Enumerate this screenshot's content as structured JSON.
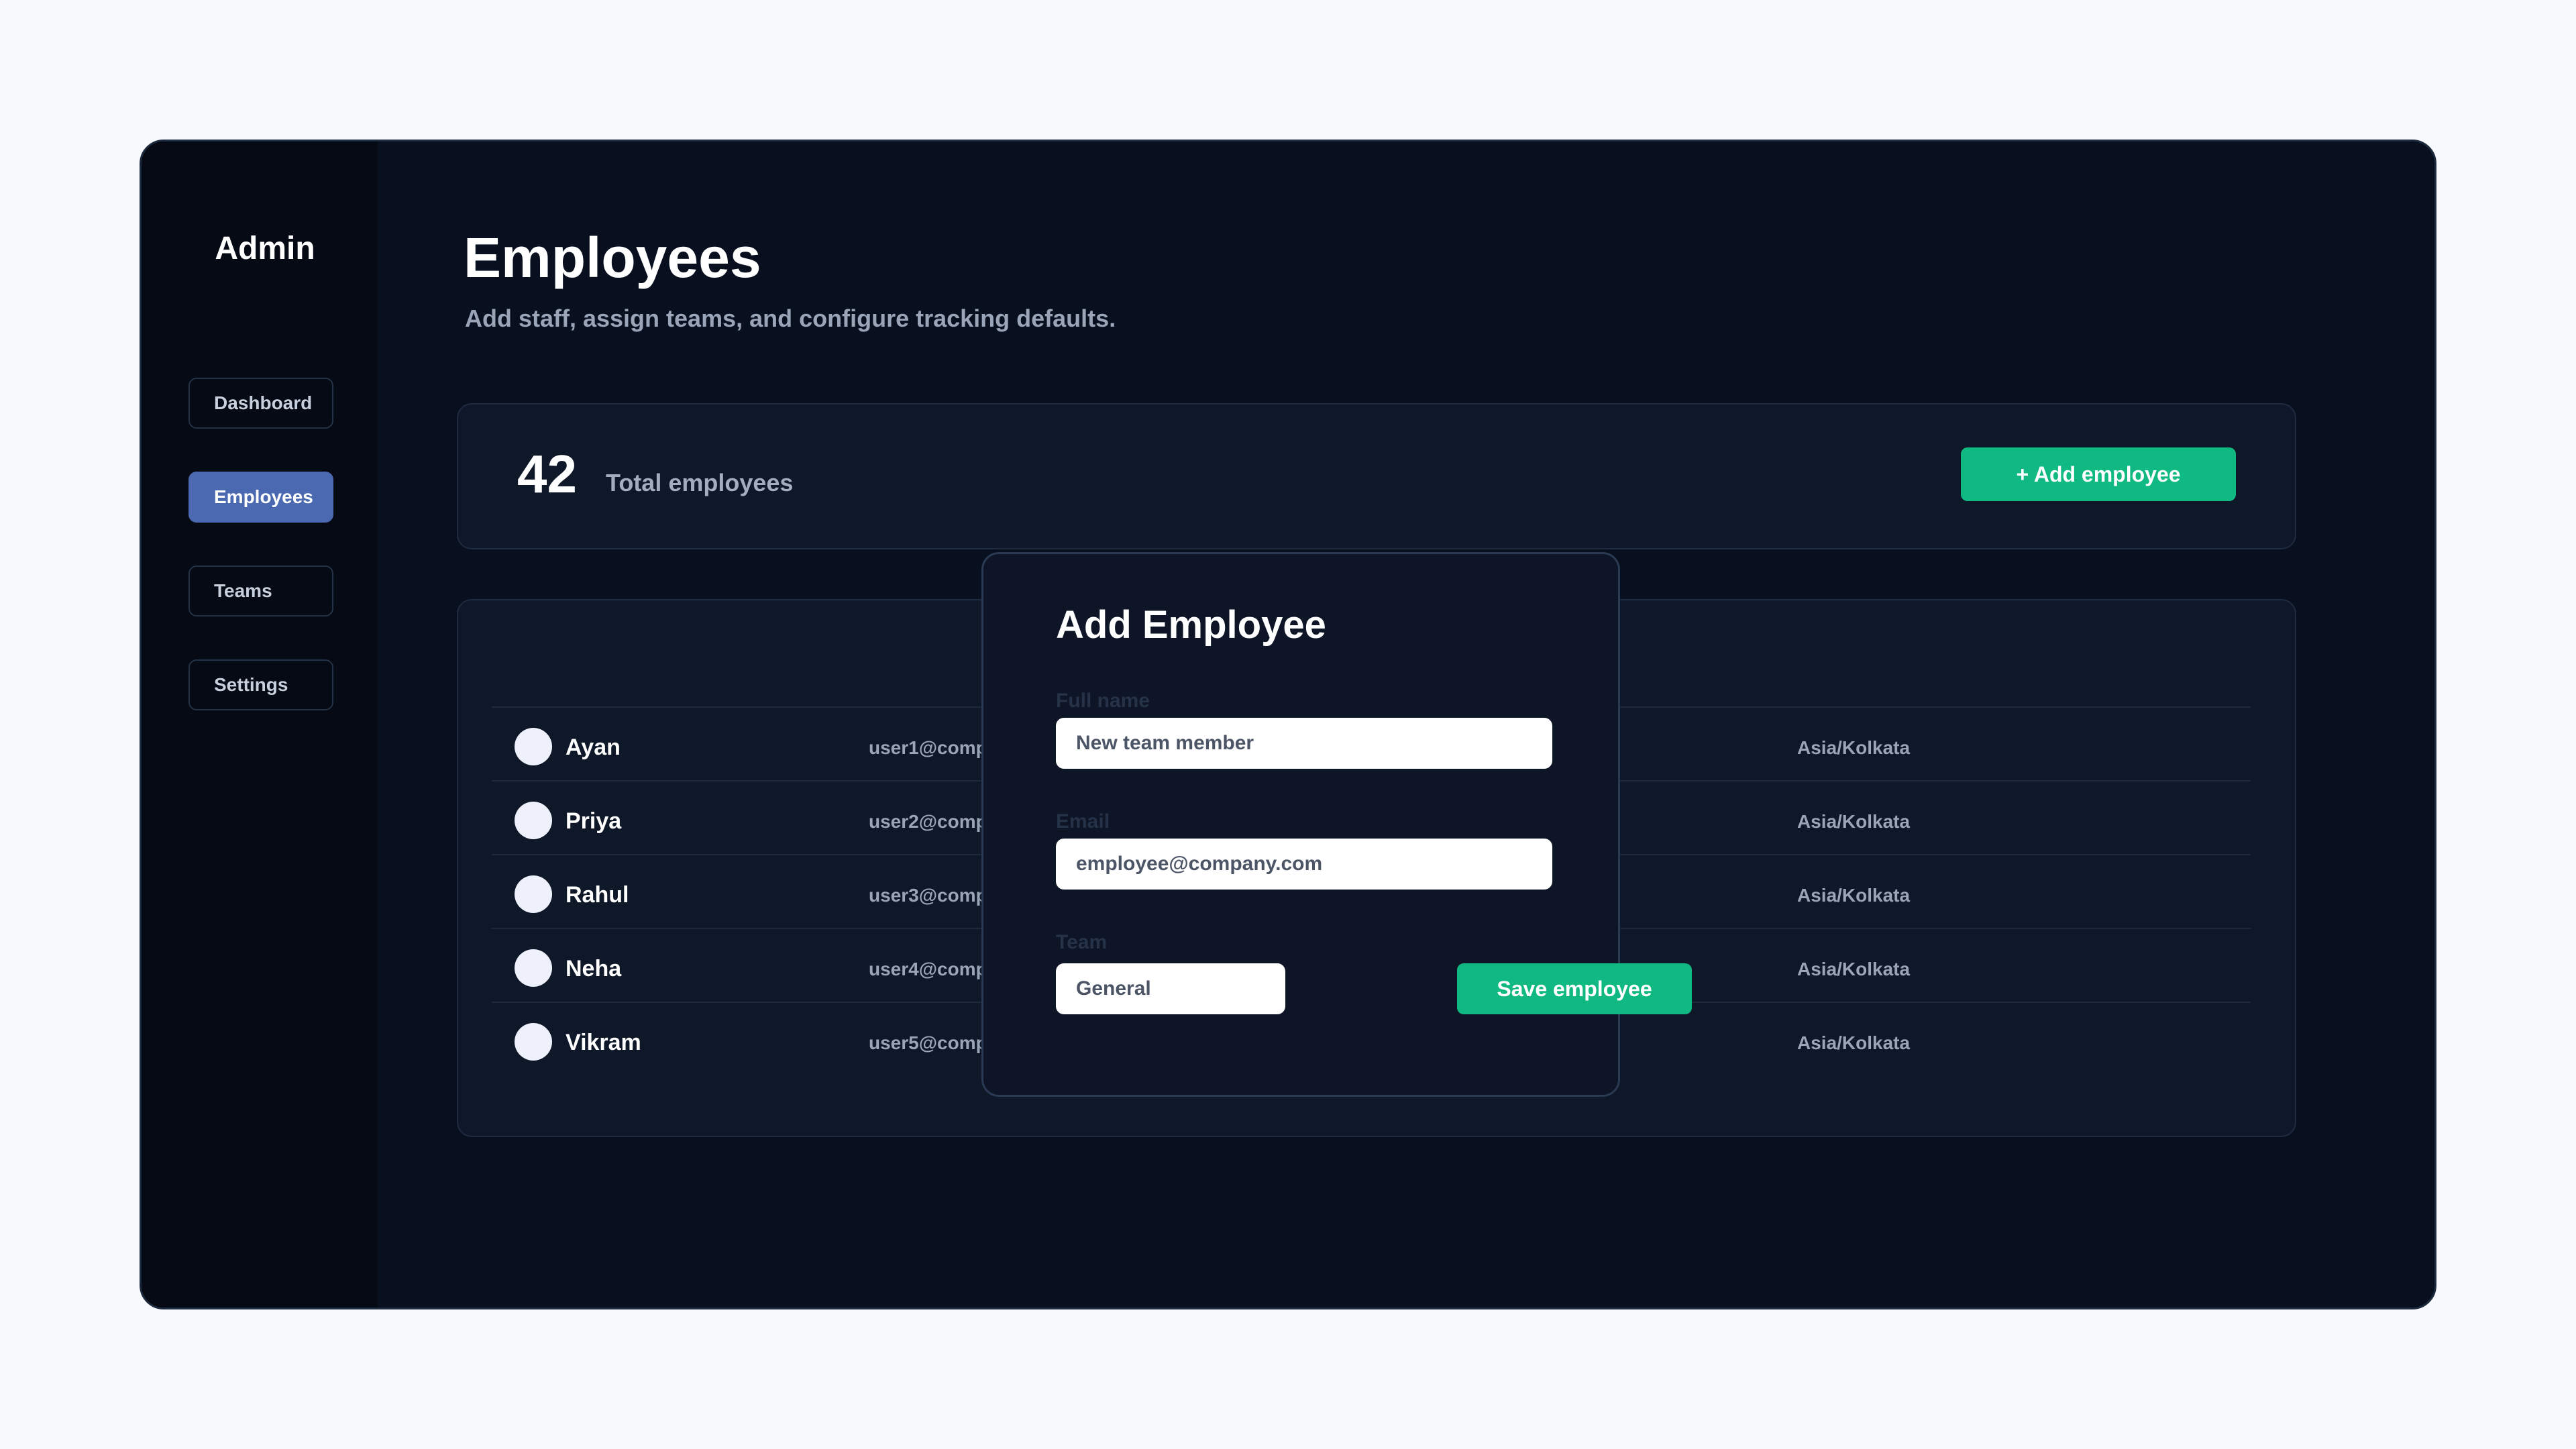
{
  "sidebar": {
    "brand": "Admin",
    "items": [
      {
        "label": "Dashboard",
        "active": false
      },
      {
        "label": "Employees",
        "active": true
      },
      {
        "label": "Teams",
        "active": false
      },
      {
        "label": "Settings",
        "active": false
      }
    ]
  },
  "header": {
    "title": "Employees",
    "subtitle": "Add staff, assign teams, and configure tracking defaults."
  },
  "stats": {
    "count": "42",
    "label": "Total employees",
    "add_button": "+ Add employee"
  },
  "employees": [
    {
      "name": "Ayan",
      "email": "user1@comp",
      "timezone": "Asia/Kolkata"
    },
    {
      "name": "Priya",
      "email": "user2@comp",
      "timezone": "Asia/Kolkata"
    },
    {
      "name": "Rahul",
      "email": "user3@comp",
      "timezone": "Asia/Kolkata"
    },
    {
      "name": "Neha",
      "email": "user4@comp",
      "timezone": "Asia/Kolkata"
    },
    {
      "name": "Vikram",
      "email": "user5@comp",
      "timezone": "Asia/Kolkata"
    }
  ],
  "modal": {
    "title": "Add Employee",
    "full_name_label": "Full name",
    "full_name_value": "New team member",
    "email_label": "Email",
    "email_value": "employee@company.com",
    "team_label": "Team",
    "team_value": "General",
    "save_button": "Save employee"
  },
  "colors": {
    "accent_green": "#10b981",
    "nav_active": "#4a69b0",
    "background": "#08101f"
  }
}
